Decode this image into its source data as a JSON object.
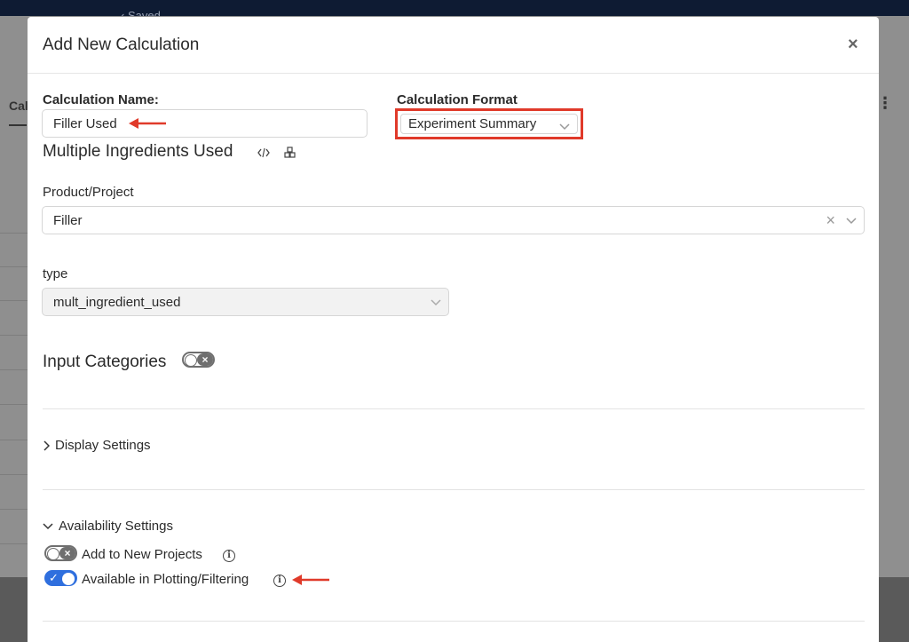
{
  "background": {
    "saved_text": "‹ Saved",
    "tab_label": "Cal",
    "menu_glyph": "⋮"
  },
  "modal": {
    "title": "Add New Calculation",
    "close_glyph": "×",
    "calculation_name": {
      "label": "Calculation Name:",
      "value": "Filler Used"
    },
    "calculation_format": {
      "label": "Calculation Format",
      "value": "Experiment Summary"
    },
    "multiple_ingredients": {
      "title": "Multiple Ingredients Used",
      "icons": [
        "code-icon",
        "cubes-icon"
      ]
    },
    "product_project": {
      "label": "Product/Project",
      "value": "Filler",
      "clear_glyph": "×"
    },
    "type": {
      "label": "type",
      "value": "mult_ingredient_used"
    },
    "input_categories": {
      "title": "Input Categories",
      "enabled": false
    },
    "display_settings": {
      "label": "Display Settings",
      "expanded": false
    },
    "availability_settings": {
      "label": "Availability Settings",
      "expanded": true,
      "options": [
        {
          "label": "Add to New Projects",
          "enabled": false
        },
        {
          "label": "Available in Plotting/Filtering",
          "enabled": true
        }
      ]
    }
  },
  "colors": {
    "accent_red": "#e03a2a",
    "toggle_on": "#2f6fde",
    "toggle_off": "#6f6f6f"
  }
}
